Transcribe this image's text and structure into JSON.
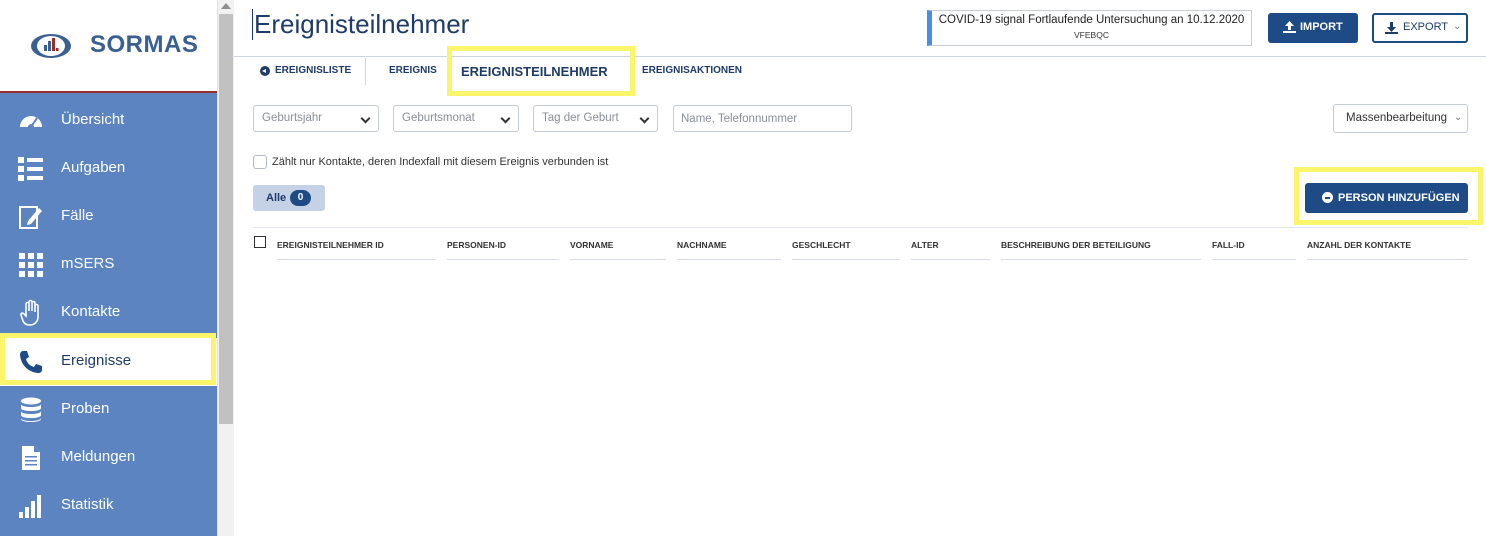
{
  "app": {
    "name": "SORMAS"
  },
  "sidebar": {
    "items": [
      {
        "label": "Übersicht",
        "icon": "dashboard-gauge-icon"
      },
      {
        "label": "Aufgaben",
        "icon": "task-list-icon"
      },
      {
        "label": "Fälle",
        "icon": "edit-document-icon"
      },
      {
        "label": "mSERS",
        "icon": "grid-icon"
      },
      {
        "label": "Kontakte",
        "icon": "hand-icon"
      },
      {
        "label": "Ereignisse",
        "icon": "phone-icon"
      },
      {
        "label": "Proben",
        "icon": "database-icon"
      },
      {
        "label": "Meldungen",
        "icon": "document-icon"
      },
      {
        "label": "Statistik",
        "icon": "bar-chart-icon"
      }
    ],
    "active": "Ereignisse"
  },
  "header": {
    "title": "Ereignisteilnehmer",
    "event_title": "COVID-19 signal Fortlaufende Untersuchung an 10.12.2020",
    "event_code": "VFEBQC",
    "import_label": "IMPORT",
    "export_label": "EXPORT"
  },
  "tabs": {
    "back_label": "EREIGNISLISTE",
    "items": [
      "EREIGNIS",
      "EREIGNISTEILNEHMER",
      "EREIGNISAKTIONEN"
    ],
    "active": "EREIGNISTEILNEHMER"
  },
  "filters": {
    "birth_year_placeholder": "Geburtsjahr",
    "birth_month_placeholder": "Geburtsmonat",
    "birth_day_placeholder": "Tag der Geburt",
    "search_placeholder": "Name, Telefonnummer",
    "mass_edit_label": "Massenbearbeitung",
    "checkbox_label": "Zählt nur Kontakte, deren Indexfall mit diesem Ereignis verbunden ist"
  },
  "list": {
    "all_label": "Alle",
    "all_count": "0",
    "add_person_label": "PERSON HINZUFÜGEN"
  },
  "table": {
    "columns": [
      "EREIGNISTEILNEHMER ID",
      "PERSONEN-ID",
      "VORNAME",
      "NACHNAME",
      "GESCHLECHT",
      "ALTER",
      "BESCHREIBUNG DER BETEILIGUNG",
      "FALL-ID",
      "ANZAHL DER KONTAKTE"
    ],
    "rows": []
  },
  "colors": {
    "sidebar_bg": "#5b84c0",
    "primary": "#1e4b86",
    "title_text": "#1f3b67",
    "highlight": "#fbf56b"
  }
}
